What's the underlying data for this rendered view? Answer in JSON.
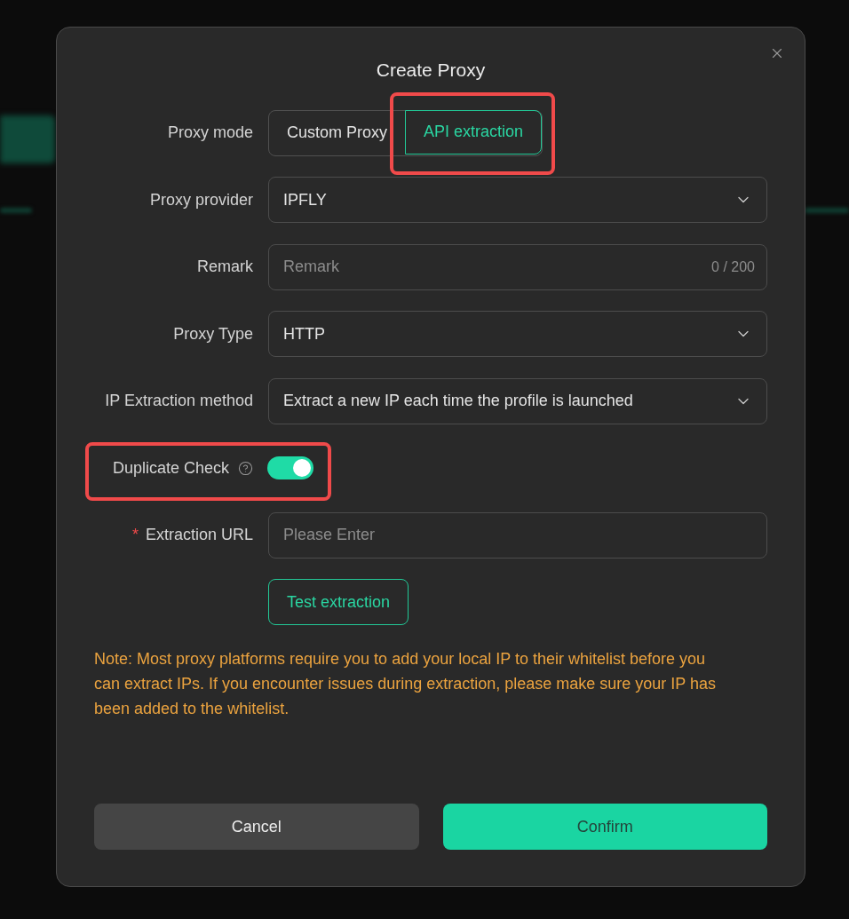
{
  "dialog": {
    "title": "Create Proxy"
  },
  "form": [
    {
      "kind": "segmented",
      "label": "Proxy mode",
      "highlighted": false,
      "options": [
        {
          "label": "Custom Proxy",
          "selected": false,
          "highlighted": false
        },
        {
          "label": "API extraction",
          "selected": true,
          "highlighted": true
        }
      ]
    },
    {
      "kind": "select",
      "label": "Proxy provider",
      "value": "IPFLY",
      "highlighted": false
    },
    {
      "kind": "text",
      "label": "Remark",
      "placeholder": "Remark",
      "counter": "0 / 200",
      "highlighted": false
    },
    {
      "kind": "select",
      "label": "Proxy Type",
      "value": "HTTP",
      "highlighted": false
    },
    {
      "kind": "select",
      "label": "IP Extraction method",
      "value": "Extract a new IP each time the profile is launched",
      "highlighted": false
    },
    {
      "kind": "toggle",
      "label": "Duplicate Check",
      "help": true,
      "on": true,
      "highlighted": true
    },
    {
      "kind": "text",
      "label": "Extraction URL",
      "required_mark": "*",
      "placeholder": "Please Enter",
      "highlighted": false
    },
    {
      "kind": "button",
      "button": "Test extraction",
      "highlighted": false
    }
  ],
  "note": "Note: Most proxy platforms require you to add your local IP to their whitelist before you can extract IPs. If you encounter issues during extraction, please make sure your IP has been added to the whitelist.",
  "buttons": [
    {
      "label": "Cancel",
      "kind": "secondary"
    },
    {
      "label": "Confirm",
      "kind": "primary"
    }
  ]
}
